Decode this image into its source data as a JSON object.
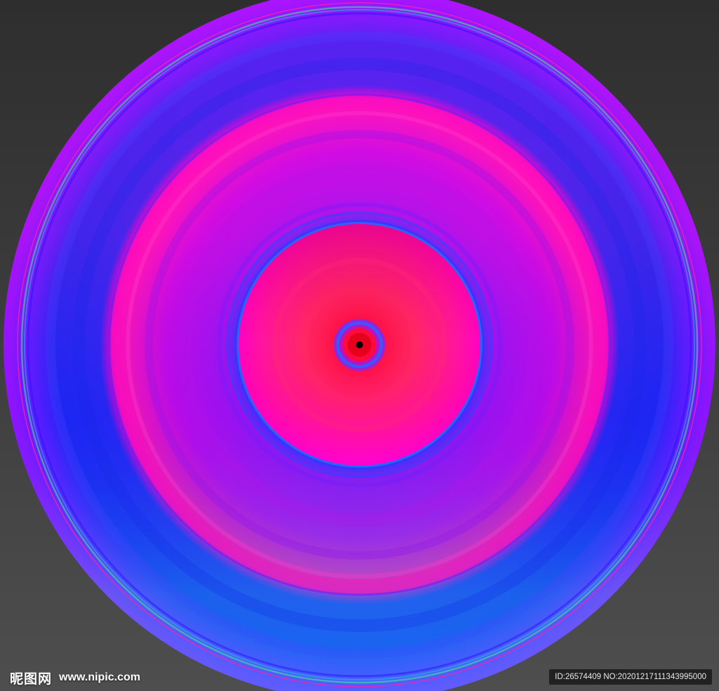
{
  "image": {
    "subject": "concentric-ring-disc",
    "colors": {
      "background": "#3a3a3a",
      "outer_violet": "#9a14ff",
      "blue": "#1e28f0",
      "cyan": "#14c8e6",
      "green": "#3cf08c",
      "magenta": "#ff14b4",
      "purple": "#b40ae6",
      "red": "#ff0a46",
      "pink": "#ff00d2",
      "center_dot": "#000000"
    }
  },
  "watermark": {
    "brand_cn": "昵图网",
    "brand_url": "www.nipic.com",
    "id_text": "ID:26574409 NO:20201217111343995000"
  }
}
